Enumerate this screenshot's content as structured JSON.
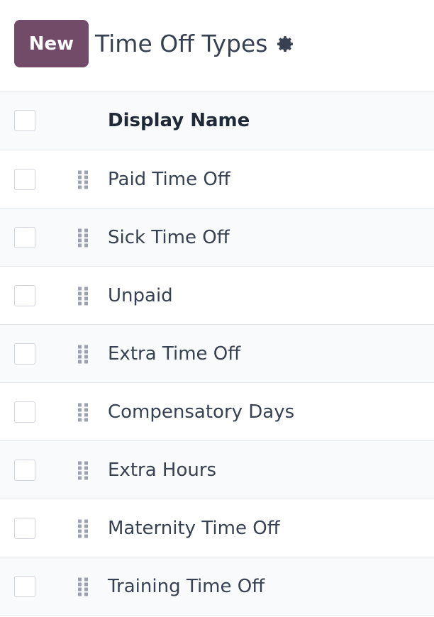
{
  "control_panel": {
    "new_button_label": "New",
    "title": "Time Off Types",
    "settings_icon": "gear-icon"
  },
  "list": {
    "column_header": "Display Name",
    "drag_icon": "drag-handle-icon",
    "rows": [
      {
        "name": "Paid Time Off"
      },
      {
        "name": "Sick Time Off"
      },
      {
        "name": "Unpaid"
      },
      {
        "name": "Extra Time Off"
      },
      {
        "name": "Compensatory Days"
      },
      {
        "name": "Extra Hours"
      },
      {
        "name": "Maternity Time Off"
      },
      {
        "name": "Training Time Off"
      }
    ]
  },
  "colors": {
    "primary": "#714b67",
    "text": "#374151",
    "border": "#e5e7eb",
    "header_bg": "#f9fafb"
  }
}
